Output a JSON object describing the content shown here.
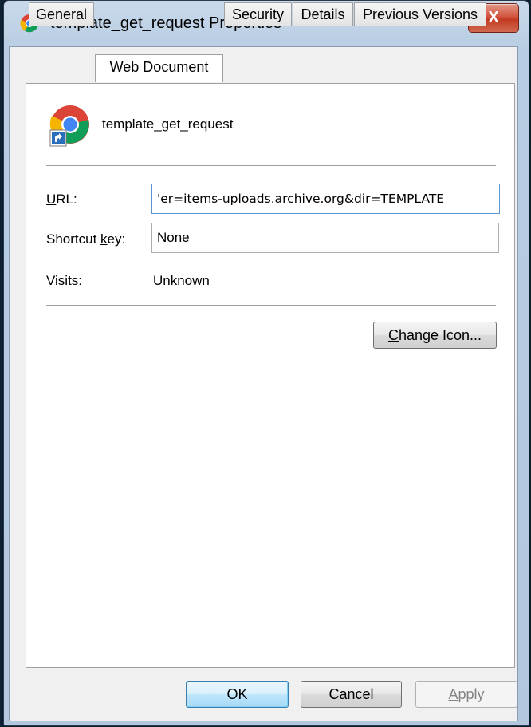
{
  "window": {
    "title": "template_get_request Properties",
    "close_glyph": "X"
  },
  "tabs": [
    {
      "label": "General",
      "active": false
    },
    {
      "label": "Web Document",
      "active": true
    },
    {
      "label": "Security",
      "active": false
    },
    {
      "label": "Details",
      "active": false
    },
    {
      "label": "Previous Versions",
      "active": false
    }
  ],
  "shortcut": {
    "name": "template_get_request",
    "icon": "chrome-shortcut-icon"
  },
  "fields": {
    "url_label_prefix": "",
    "url_label_mnemonic": "U",
    "url_label_rest": "RL:",
    "url_value": "'er=items-uploads.archive.org&dir=TEMPLATE",
    "shortcut_key_label_prefix": "Shortcut ",
    "shortcut_key_label_mnemonic": "k",
    "shortcut_key_label_rest": "ey:",
    "shortcut_key_value": "None",
    "visits_label": "Visits:",
    "visits_value": "Unknown"
  },
  "buttons": {
    "change_icon_mnemonic": "C",
    "change_icon_rest": "hange Icon...",
    "ok": "OK",
    "cancel": "Cancel",
    "apply_mnemonic": "A",
    "apply_rest": "pply"
  },
  "colors": {
    "close_button": "#c94a33",
    "default_button_border": "#3c7fb1",
    "url_focus_border": "#5c95d0"
  }
}
